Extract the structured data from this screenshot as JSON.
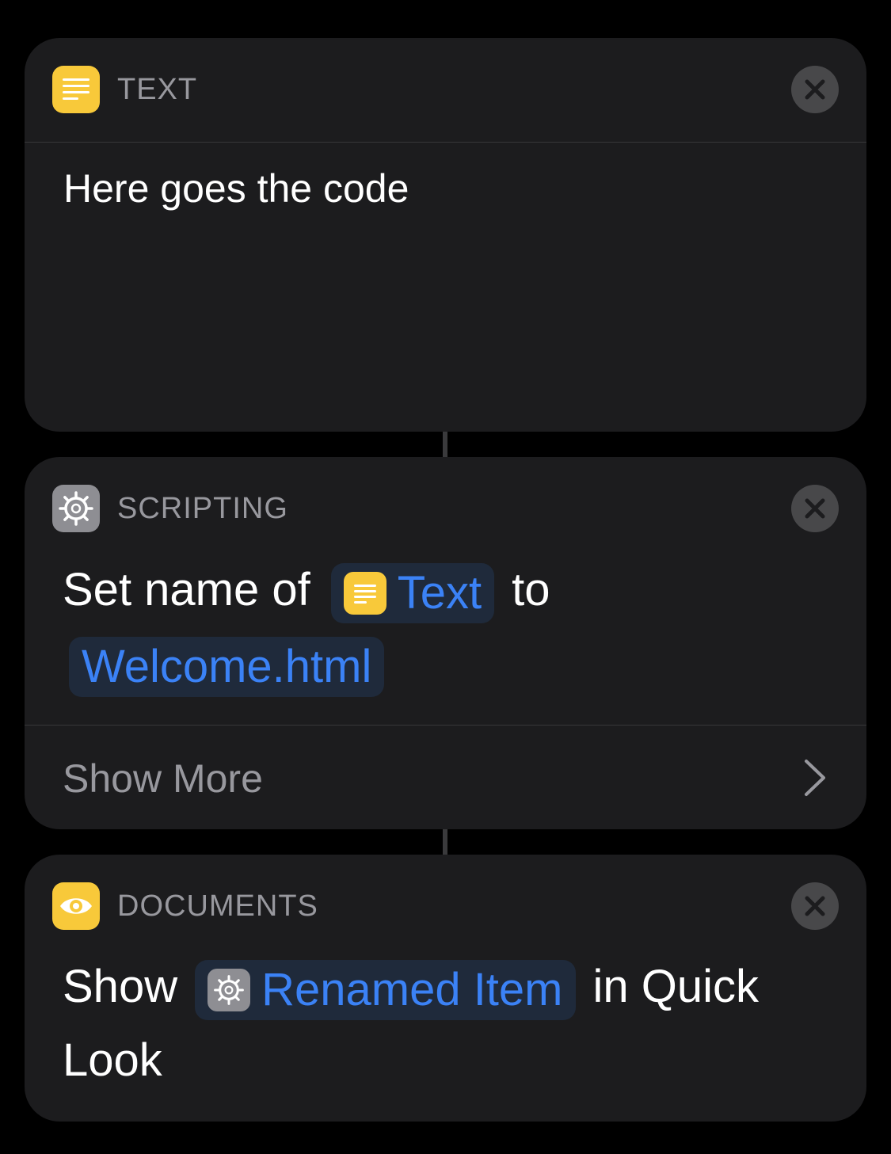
{
  "actions": {
    "text": {
      "category": "TEXT",
      "icon": "text-lines-icon",
      "body": "Here goes the code"
    },
    "scripting": {
      "category": "SCRIPTING",
      "icon": "gear-icon",
      "prefix": "Set name of",
      "input_token": "Text",
      "middle": "to",
      "name_token": "Welcome.html",
      "show_more": "Show More"
    },
    "documents": {
      "category": "DOCUMENTS",
      "icon": "eye-icon",
      "prefix": "Show",
      "input_token": "Renamed Item",
      "suffix": "in Quick Look"
    }
  },
  "colors": {
    "background": "#000000",
    "card": "#1c1c1e",
    "accent": "#3b82f6",
    "text_icon_yellow": "#f8c93a",
    "scripting_gray": "#8e8e93"
  }
}
